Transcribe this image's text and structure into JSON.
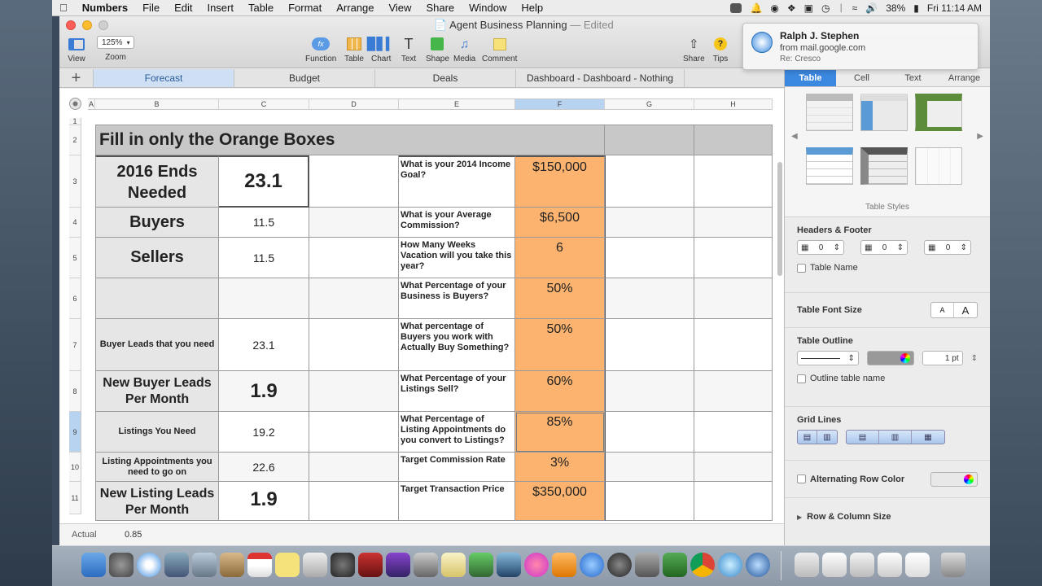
{
  "menubar": {
    "app": "Numbers",
    "items": [
      "File",
      "Edit",
      "Insert",
      "Table",
      "Format",
      "Arrange",
      "View",
      "Share",
      "Window",
      "Help"
    ],
    "battery": "38%",
    "clock": "Fri 11:14 AM"
  },
  "window": {
    "title": "Agent Business Planning",
    "status": "— Edited"
  },
  "toolbar": {
    "view": "View",
    "zoom_value": "125%",
    "zoom": "Zoom",
    "function": "Function",
    "table": "Table",
    "chart": "Chart",
    "text": "Text",
    "shape": "Shape",
    "media": "Media",
    "comment": "Comment",
    "share": "Share",
    "tips": "Tips"
  },
  "notification": {
    "name": "Ralph J. Stephen",
    "from": "from mail.google.com",
    "subject": "Re: Cresco"
  },
  "sheets": [
    "Forecast",
    "Budget",
    "Deals",
    "Dashboard - Dashboard - Nothing"
  ],
  "columns": [
    "A",
    "B",
    "C",
    "D",
    "E",
    "F",
    "G",
    "H"
  ],
  "rows": [
    "1",
    "2",
    "3",
    "4",
    "5",
    "6",
    "7",
    "8",
    "9",
    "10",
    "11"
  ],
  "table": {
    "header": "Fill in only the Orange Boxes",
    "r3": {
      "b": "2016 Ends Needed",
      "c": "23.1",
      "e": "What is your 2014 Income Goal?",
      "f": "$150,000"
    },
    "r4": {
      "b": "Buyers",
      "c": "11.5",
      "e": "What is your Average Commission?",
      "f": "$6,500"
    },
    "r5": {
      "b": "Sellers",
      "c": "11.5",
      "e": "How Many Weeks Vacation will you take this year?",
      "f": "6"
    },
    "r6": {
      "b": "",
      "c": "",
      "e": "What Percentage of your Business is Buyers?",
      "f": "50%"
    },
    "r7": {
      "b": "Buyer Leads that you need",
      "c": "23.1",
      "e": "What percentage of Buyers you work with Actually Buy Something?",
      "f": "50%"
    },
    "r8": {
      "b": "New Buyer Leads Per Month",
      "c": "1.9",
      "e": "What Percentage of your Listings Sell?",
      "f": "60%"
    },
    "r9": {
      "b": "Listings You Need",
      "c": "19.2",
      "e": "What Percentage of Listing Appointments do you convert to Listings?",
      "f": "85%"
    },
    "r10": {
      "b": "Listing Appointments you need to go on",
      "c": "22.6",
      "e": "Target Commission Rate",
      "f": "3%"
    },
    "r11": {
      "b": "New Listing Leads Per Month",
      "c": "1.9",
      "e": "Target Transaction Price",
      "f": "$350,000"
    }
  },
  "formula": {
    "label": "Actual",
    "value": "0.85"
  },
  "inspector": {
    "tabs": [
      "Table",
      "Cell",
      "Text",
      "Arrange"
    ],
    "styles_label": "Table Styles",
    "headers_footer": "Headers & Footer",
    "hf_values": [
      "0",
      "0",
      "0"
    ],
    "table_name": "Table Name",
    "font_size": "Table Font Size",
    "font_small": "A",
    "font_large": "A",
    "outline": "Table Outline",
    "outline_pt": "1 pt",
    "outline_name": "Outline table name",
    "grid_lines": "Grid Lines",
    "alt_row": "Alternating Row Color",
    "row_col_size": "Row & Column Size"
  }
}
